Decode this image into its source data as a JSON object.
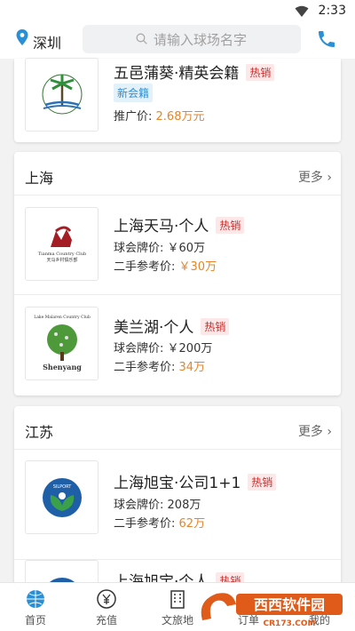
{
  "status_bar": {
    "time": "2:33"
  },
  "header": {
    "city": "深圳",
    "search_placeholder": "请输入球场名字"
  },
  "top_item": {
    "name": "五邑蒲葵·精英会籍",
    "hot": "热销",
    "tag": "新会籍",
    "price_label": "推广价:",
    "price_value": "2.68万元"
  },
  "shanghai": {
    "title": "上海",
    "more": "更多",
    "items": [
      {
        "name": "上海天马·个人",
        "hot": "热销",
        "club_label": "球会牌价:",
        "club_value": "￥60万",
        "used_label": "二手参考价:",
        "used_value": "￥30万",
        "logo_text": "Tianma Country Club",
        "logo_cn": "天马乡村俱乐部"
      },
      {
        "name": "美兰湖·个人",
        "hot": "热销",
        "club_label": "球会牌价:",
        "club_value": "￥200万",
        "used_label": "二手参考价:",
        "used_value": "34万",
        "logo_text": "Shenyang",
        "logo_top": "Lake Malaren Country Club"
      }
    ]
  },
  "jiangsu": {
    "title": "江苏",
    "more": "更多",
    "items": [
      {
        "name": "上海旭宝·公司1+1",
        "hot": "热销",
        "club_label": "球会牌价:",
        "club_value": "208万",
        "used_label": "二手参考价:",
        "used_value": "62万",
        "logo_text": "SILPORT"
      },
      {
        "name": "上海旭宝·个人",
        "hot": "热销"
      }
    ]
  },
  "bottom_nav": [
    "首页",
    "充值",
    "文旅地",
    "订单",
    "我的"
  ],
  "watermark": {
    "title": "西西软件园",
    "url": "CR173.COM"
  },
  "colors": {
    "accent": "#2b8fd6",
    "hot": "#c8302e",
    "price": "#e5852a"
  }
}
